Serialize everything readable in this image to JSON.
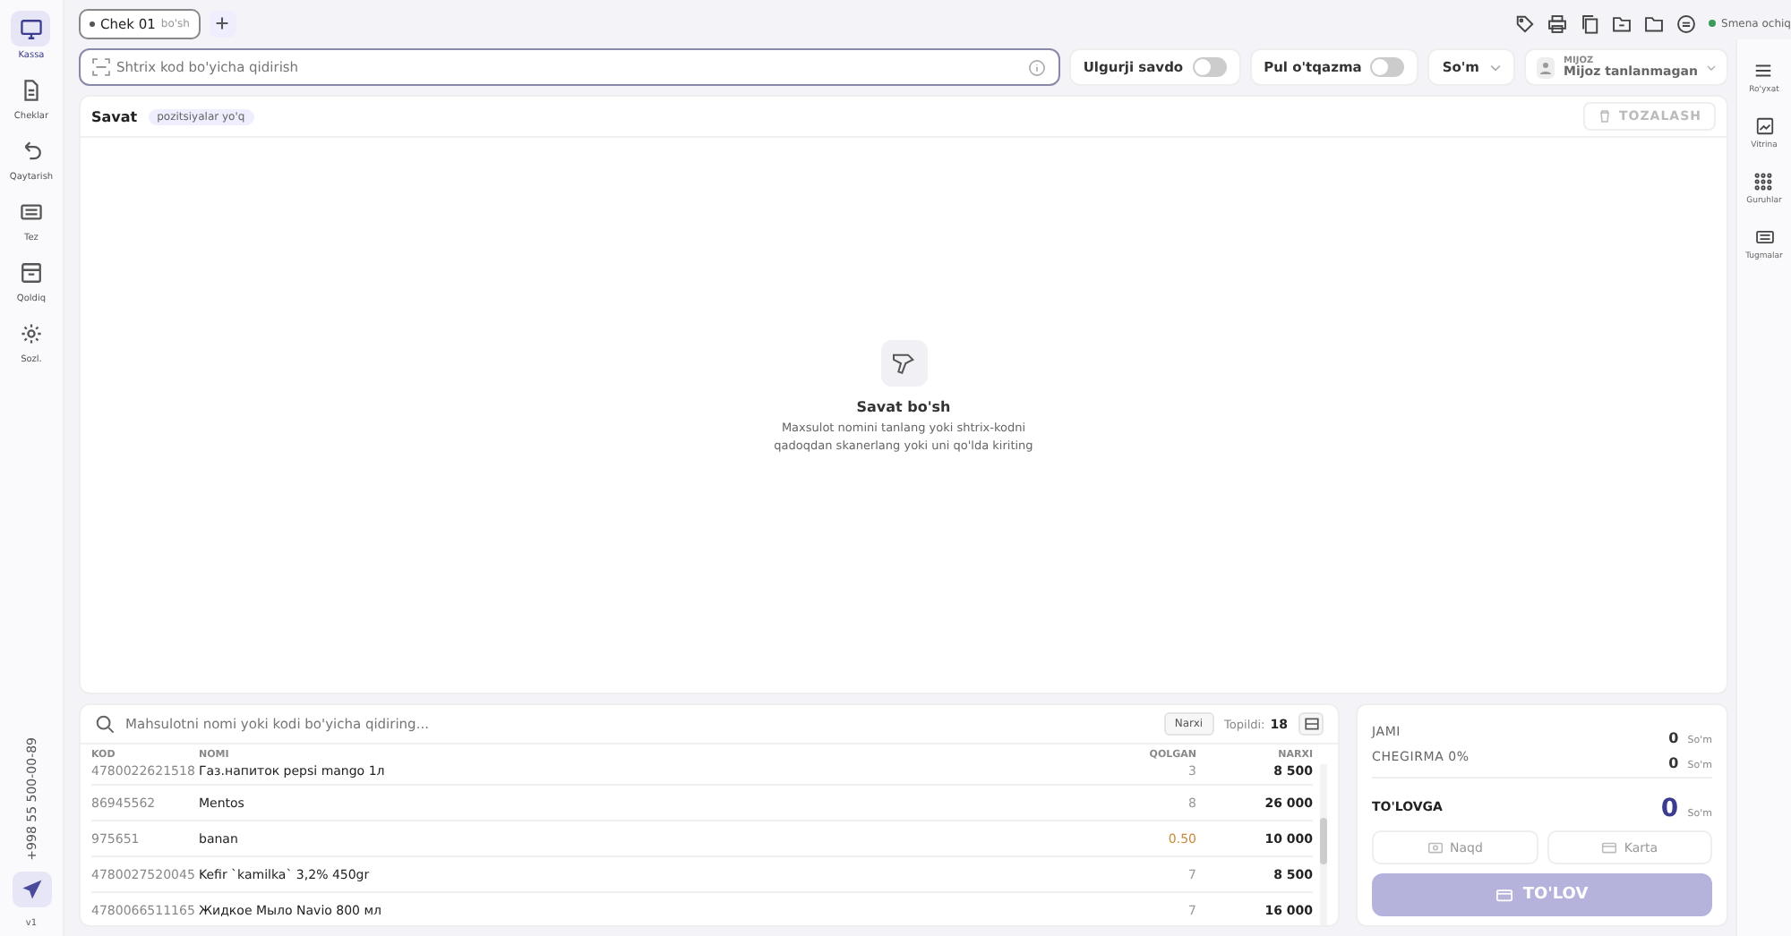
{
  "left_nav": [
    {
      "label": "Kassa",
      "selected": true
    },
    {
      "label": "Cheklar",
      "selected": false
    },
    {
      "label": "Qaytarish",
      "selected": false
    },
    {
      "label": "Tez",
      "selected": false
    },
    {
      "label": "Qoldiq",
      "selected": false
    },
    {
      "label": "Sozl.",
      "selected": false
    }
  ],
  "phone": "+998 55 500-00-89",
  "version": "v1",
  "tabs": [
    {
      "label": "Chek 01",
      "status": "bo'sh",
      "selected": true
    }
  ],
  "shift_status": "Smena ochiq",
  "barcode_search": {
    "placeholder": "Shtrix kod bo'yicha qidirish"
  },
  "toggles": [
    {
      "label": "Ulgurji savdo",
      "on": false
    },
    {
      "label": "Pul o'tqazma",
      "on": false
    }
  ],
  "currency": "So'm",
  "client": {
    "caption": "MIJOZ",
    "value": "Mijoz tanlanmagan"
  },
  "cart": {
    "title": "Savat",
    "badge": "pozitsiyalar yo'q",
    "clear_button": {
      "label": "TOZALASH",
      "disabled": true
    },
    "empty_title": "Savat bo'sh",
    "empty_text": "Maxsulot nomini tanlang yoki shtrix-kodni qadoqdan skanerlang yoki uni qo'lda kiriting"
  },
  "right_nav": [
    {
      "label": "Ro'yxat"
    },
    {
      "label": "Vitrina"
    },
    {
      "label": "Guruhlar"
    },
    {
      "label": "Tugmalar"
    }
  ],
  "products": {
    "search_placeholder": "Mahsulotni nomi yoki kodi bo'yicha qidiring...",
    "sort_chip": "Narxi",
    "found_label": "Topildi:",
    "found_count": "18",
    "columns": [
      "KOD",
      "NOMI",
      "QOLGAN",
      "NARXI"
    ],
    "rows": [
      {
        "code": "4780022621518",
        "name": "Газ.напиток pepsi mango 1л",
        "stock": "3",
        "price": "8 500",
        "low": false
      },
      {
        "code": "86945562",
        "name": "Mentos",
        "stock": "8",
        "price": "26 000",
        "low": false
      },
      {
        "code": "975651",
        "name": "banan",
        "stock": "0.50",
        "price": "10 000",
        "low": true
      },
      {
        "code": "4780027520045",
        "name": "Kefir `kamilka` 3,2% 450gr",
        "stock": "7",
        "price": "8 500",
        "low": false
      },
      {
        "code": "4780066511165",
        "name": "Жидкое Мыло Navio 800 мл",
        "stock": "7",
        "price": "16 000",
        "low": false
      }
    ]
  },
  "totals": {
    "rows": [
      {
        "label": "JAMI",
        "value": "0",
        "unit": "So'm"
      },
      {
        "label": "CHEGIRMA 0%",
        "value": "0",
        "unit": "So'm"
      }
    ],
    "due_label": "TO'LOVGA",
    "due_value": "0",
    "due_unit": "So'm",
    "methods": [
      {
        "label": "Naqd"
      },
      {
        "label": "Karta"
      }
    ],
    "pay_button": {
      "label": "TO'LOV",
      "disabled": true
    }
  }
}
